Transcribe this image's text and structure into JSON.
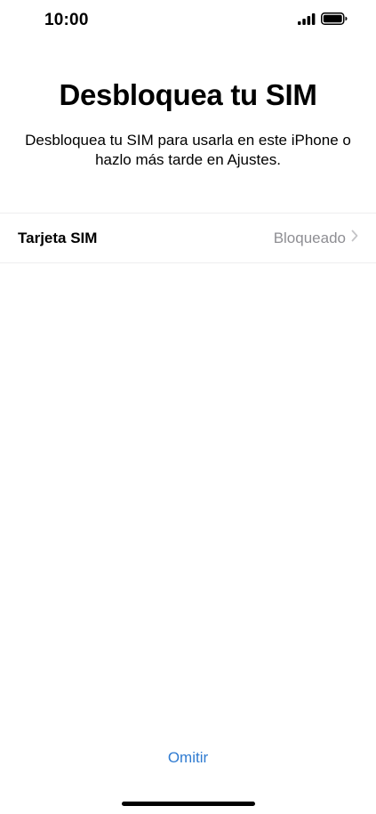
{
  "status_bar": {
    "time": "10:00",
    "signal_icon": "cellular-signal-icon",
    "battery_icon": "battery-full-icon"
  },
  "header": {
    "title": "Desbloquea tu SIM",
    "subtitle": "Desbloquea tu SIM para usarla en este iPhone o hazlo más tarde en Ajustes."
  },
  "sim_row": {
    "label": "Tarjeta SIM",
    "value": "Bloqueado",
    "chevron_icon": "chevron-right-icon"
  },
  "footer": {
    "skip_label": "Omitir"
  },
  "colors": {
    "accent": "#2f7bd1",
    "secondary_text": "#8e8e93",
    "separator": "#eeeeef"
  }
}
